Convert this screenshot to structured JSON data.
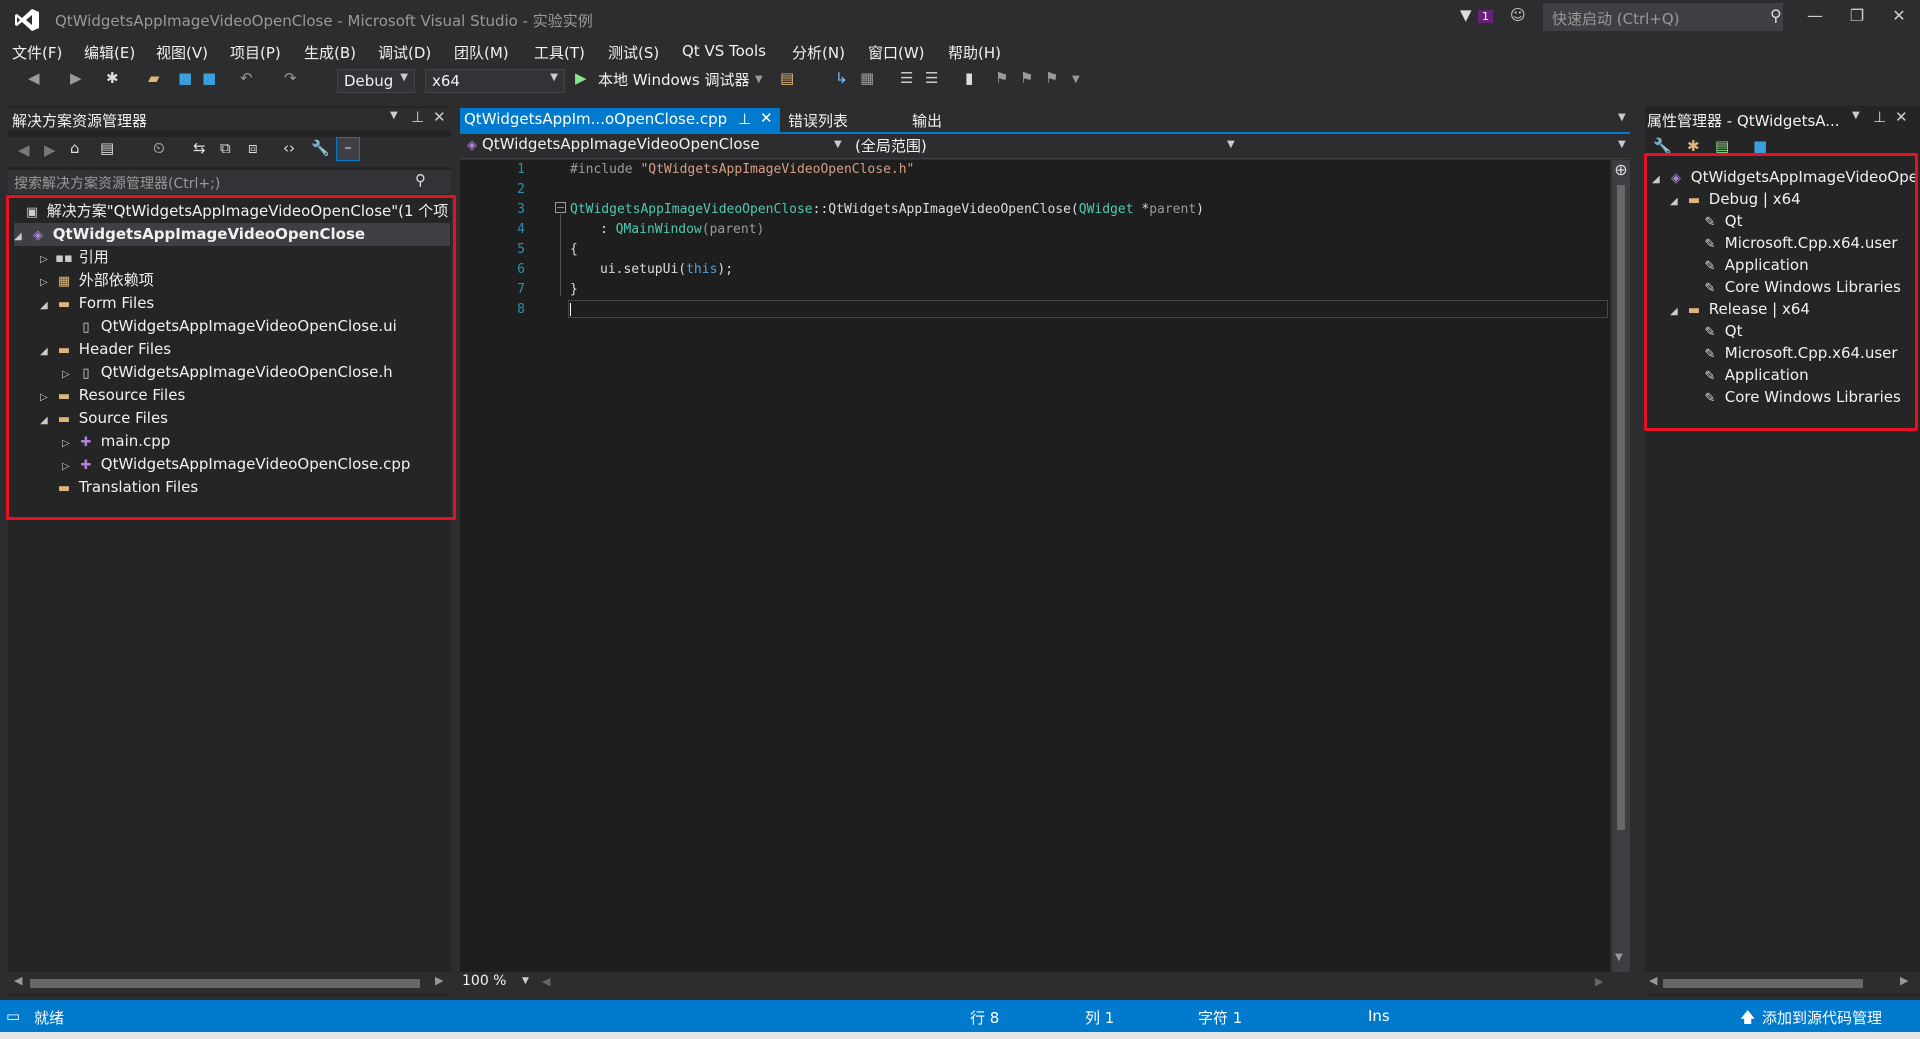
{
  "window": {
    "title": "QtWidgetsAppImageVideoOpenClose - Microsoft Visual Studio - 实验实例",
    "notification_count": "1",
    "quick_launch_placeholder": "快速启动 (Ctrl+Q)"
  },
  "menu": [
    "文件(F)",
    "编辑(E)",
    "视图(V)",
    "项目(P)",
    "生成(B)",
    "调试(D)",
    "团队(M)",
    "工具(T)",
    "测试(S)",
    "Qt VS Tools",
    "分析(N)",
    "窗口(W)",
    "帮助(H)"
  ],
  "toolbar": {
    "config": "Debug",
    "platform": "x64",
    "run_label": "本地 Windows 调试器"
  },
  "solution_explorer": {
    "title": "解决方案资源管理器",
    "search_placeholder": "搜索解决方案资源管理器(Ctrl+;)",
    "items": [
      {
        "label": "解决方案\"QtWidgetsAppImageVideoOpenClose\"(1 个项",
        "icon": "solution-icon"
      },
      {
        "label": "QtWidgetsAppImageVideoOpenClose",
        "icon": "project-icon"
      },
      {
        "label": "引用",
        "icon": "references-icon"
      },
      {
        "label": "外部依赖项",
        "icon": "external-deps-icon"
      },
      {
        "label": "Form Files",
        "icon": "folder-icon"
      },
      {
        "label": "QtWidgetsAppImageVideoOpenClose.ui",
        "icon": "file-icon"
      },
      {
        "label": "Header Files",
        "icon": "folder-icon"
      },
      {
        "label": "QtWidgetsAppImageVideoOpenClose.h",
        "icon": "file-icon"
      },
      {
        "label": "Resource Files",
        "icon": "folder-icon"
      },
      {
        "label": "Source Files",
        "icon": "folder-icon"
      },
      {
        "label": "main.cpp",
        "icon": "cpp-file-icon"
      },
      {
        "label": "QtWidgetsAppImageVideoOpenClose.cpp",
        "icon": "cpp-file-icon"
      },
      {
        "label": "Translation Files",
        "icon": "folder-icon"
      }
    ]
  },
  "editor": {
    "active_tab": "QtWidgetsAppIm...oOpenClose.cpp",
    "other_tabs": [
      "错误列表",
      "输出"
    ],
    "nav_project": "QtWidgetsAppImageVideoOpenClose",
    "nav_scope": "(全局范围)",
    "line_numbers": [
      "1",
      "2",
      "3",
      "4",
      "5",
      "6",
      "7",
      "8"
    ],
    "zoom": "100 %"
  },
  "code": {
    "l1_pp": "#include ",
    "l1_str": "\"QtWidgetsAppImageVideoOpenClose.h\"",
    "l3_class": "QtWidgetsAppImageVideoOpenClose",
    "l3_sep": "::QtWidgetsAppImageVideoOpenClose(",
    "l3_type": "QWidget",
    "l3_rest": " *",
    "l3_param": "parent",
    "l3_close": ")",
    "l4_pre": ": ",
    "l4_type": "QMainWindow",
    "l4_args": "(parent)",
    "l5": "{",
    "l6_pre": "ui.setupUi(",
    "l6_kw": "this",
    "l6_post": ");",
    "l7": "}"
  },
  "property_manager": {
    "title": "属性管理器 - QtWidgetsA...",
    "root": "QtWidgetsAppImageVideoOpe",
    "groups": [
      {
        "label": "Debug | x64",
        "items": [
          "Qt",
          "Microsoft.Cpp.x64.user",
          "Application",
          "Core Windows Libraries"
        ]
      },
      {
        "label": "Release | x64",
        "items": [
          "Qt",
          "Microsoft.Cpp.x64.user",
          "Application",
          "Core Windows Libraries"
        ]
      }
    ]
  },
  "statusbar": {
    "ready": "就绪",
    "line": "行 8",
    "col": "列 1",
    "char": "字符 1",
    "mode": "Ins",
    "source_control": "添加到源代码管理"
  },
  "colors": {
    "accent": "#007acc",
    "highlight_box": "#e81123"
  }
}
